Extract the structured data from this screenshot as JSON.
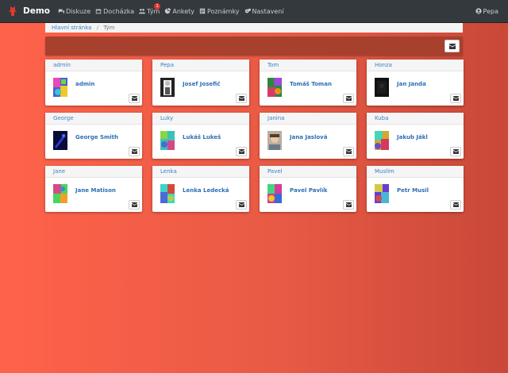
{
  "nav": {
    "brand": "Demo",
    "items": [
      {
        "label": "Diskuze",
        "icon": "comments-icon"
      },
      {
        "label": "Docházka",
        "icon": "calendar-icon"
      },
      {
        "label": "Tým",
        "icon": "users-icon",
        "badge": "1"
      },
      {
        "label": "Ankety",
        "icon": "pie-chart-icon"
      },
      {
        "label": "Poznámky",
        "icon": "notes-icon"
      },
      {
        "label": "Nastavení",
        "icon": "gears-icon"
      }
    ],
    "user": "Pepa"
  },
  "breadcrumb": {
    "home": "Hlavní stránka",
    "current": "Tým"
  },
  "members": [
    {
      "username": "admin",
      "fullname": "admin",
      "avatar": "admin"
    },
    {
      "username": "Pepa",
      "fullname": "Josef Josefič",
      "avatar": "pepa"
    },
    {
      "username": "Tom",
      "fullname": "Tomáš Toman",
      "avatar": "tom"
    },
    {
      "username": "Honza",
      "fullname": "Jan Janda",
      "avatar": "honza"
    },
    {
      "username": "George",
      "fullname": "George Smith",
      "avatar": "george"
    },
    {
      "username": "Luky",
      "fullname": "Lukáš Lukeš",
      "avatar": "luky"
    },
    {
      "username": "Janina",
      "fullname": "Jana Jaslová",
      "avatar": "janina"
    },
    {
      "username": "Kuba",
      "fullname": "Jakub Jákl",
      "avatar": "kuba"
    },
    {
      "username": "Jane",
      "fullname": "Jane Matison",
      "avatar": "jane"
    },
    {
      "username": "Lenka",
      "fullname": "Lenka Ledecká",
      "avatar": "lenka"
    },
    {
      "username": "Pavel",
      "fullname": "Pavel Pavlík",
      "avatar": "pavel"
    },
    {
      "username": "Muslim",
      "fullname": "Petr Musil",
      "avatar": "muslim"
    }
  ],
  "colors": {
    "accent": "#3b7fc4",
    "navbar": "#34393d",
    "banner": "#a8402e",
    "background": "#ff624a"
  }
}
